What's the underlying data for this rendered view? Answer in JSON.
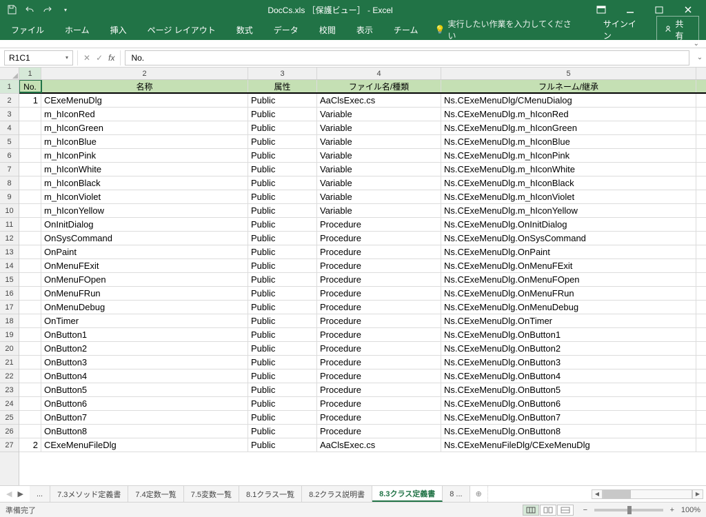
{
  "titlebar": {
    "title": "DocCs.xls ［保護ビュー］ - Excel"
  },
  "ribbon": {
    "tabs": [
      "ファイル",
      "ホーム",
      "挿入",
      "ページ レイアウト",
      "数式",
      "データ",
      "校閲",
      "表示",
      "チーム"
    ],
    "tellme": "実行したい作業を入力してください",
    "signin": "サインイン",
    "share": "共有"
  },
  "namebox": "R1C1",
  "formula": "No.",
  "columns": [
    "1",
    "2",
    "3",
    "4",
    "5"
  ],
  "headers": {
    "c1": "No.",
    "c2": "名称",
    "c3": "属性",
    "c4": "ファイル名/種類",
    "c5": "フルネーム/継承"
  },
  "rows": [
    {
      "no": "1",
      "name": "CExeMenuDlg",
      "attr": "Public",
      "file": "AaClsExec.cs",
      "full": "Ns.CExeMenuDlg/CMenuDialog"
    },
    {
      "no": "",
      "name": "m_hIconRed",
      "attr": "Public",
      "file": "Variable",
      "full": "Ns.CExeMenuDlg.m_hIconRed"
    },
    {
      "no": "",
      "name": "m_hIconGreen",
      "attr": "Public",
      "file": "Variable",
      "full": "Ns.CExeMenuDlg.m_hIconGreen"
    },
    {
      "no": "",
      "name": "m_hIconBlue",
      "attr": "Public",
      "file": "Variable",
      "full": "Ns.CExeMenuDlg.m_hIconBlue"
    },
    {
      "no": "",
      "name": "m_hIconPink",
      "attr": "Public",
      "file": "Variable",
      "full": "Ns.CExeMenuDlg.m_hIconPink"
    },
    {
      "no": "",
      "name": "m_hIconWhite",
      "attr": "Public",
      "file": "Variable",
      "full": "Ns.CExeMenuDlg.m_hIconWhite"
    },
    {
      "no": "",
      "name": "m_hIconBlack",
      "attr": "Public",
      "file": "Variable",
      "full": "Ns.CExeMenuDlg.m_hIconBlack"
    },
    {
      "no": "",
      "name": "m_hIconViolet",
      "attr": "Public",
      "file": "Variable",
      "full": "Ns.CExeMenuDlg.m_hIconViolet"
    },
    {
      "no": "",
      "name": "m_hIconYellow",
      "attr": "Public",
      "file": "Variable",
      "full": "Ns.CExeMenuDlg.m_hIconYellow"
    },
    {
      "no": "",
      "name": "OnInitDialog",
      "attr": "Public",
      "file": "Procedure",
      "full": "Ns.CExeMenuDlg.OnInitDialog"
    },
    {
      "no": "",
      "name": "OnSysCommand",
      "attr": "Public",
      "file": "Procedure",
      "full": "Ns.CExeMenuDlg.OnSysCommand"
    },
    {
      "no": "",
      "name": "OnPaint",
      "attr": "Public",
      "file": "Procedure",
      "full": "Ns.CExeMenuDlg.OnPaint"
    },
    {
      "no": "",
      "name": "OnMenuFExit",
      "attr": "Public",
      "file": "Procedure",
      "full": "Ns.CExeMenuDlg.OnMenuFExit"
    },
    {
      "no": "",
      "name": "OnMenuFOpen",
      "attr": "Public",
      "file": "Procedure",
      "full": "Ns.CExeMenuDlg.OnMenuFOpen"
    },
    {
      "no": "",
      "name": "OnMenuFRun",
      "attr": "Public",
      "file": "Procedure",
      "full": "Ns.CExeMenuDlg.OnMenuFRun"
    },
    {
      "no": "",
      "name": "OnMenuDebug",
      "attr": "Public",
      "file": "Procedure",
      "full": "Ns.CExeMenuDlg.OnMenuDebug"
    },
    {
      "no": "",
      "name": "OnTimer",
      "attr": "Public",
      "file": "Procedure",
      "full": "Ns.CExeMenuDlg.OnTimer"
    },
    {
      "no": "",
      "name": "OnButton1",
      "attr": "Public",
      "file": "Procedure",
      "full": "Ns.CExeMenuDlg.OnButton1"
    },
    {
      "no": "",
      "name": "OnButton2",
      "attr": "Public",
      "file": "Procedure",
      "full": "Ns.CExeMenuDlg.OnButton2"
    },
    {
      "no": "",
      "name": "OnButton3",
      "attr": "Public",
      "file": "Procedure",
      "full": "Ns.CExeMenuDlg.OnButton3"
    },
    {
      "no": "",
      "name": "OnButton4",
      "attr": "Public",
      "file": "Procedure",
      "full": "Ns.CExeMenuDlg.OnButton4"
    },
    {
      "no": "",
      "name": "OnButton5",
      "attr": "Public",
      "file": "Procedure",
      "full": "Ns.CExeMenuDlg.OnButton5"
    },
    {
      "no": "",
      "name": "OnButton6",
      "attr": "Public",
      "file": "Procedure",
      "full": "Ns.CExeMenuDlg.OnButton6"
    },
    {
      "no": "",
      "name": "OnButton7",
      "attr": "Public",
      "file": "Procedure",
      "full": "Ns.CExeMenuDlg.OnButton7"
    },
    {
      "no": "",
      "name": "OnButton8",
      "attr": "Public",
      "file": "Procedure",
      "full": "Ns.CExeMenuDlg.OnButton8"
    },
    {
      "no": "2",
      "name": "CExeMenuFileDlg",
      "attr": "Public",
      "file": "AaClsExec.cs",
      "full": "Ns.CExeMenuFileDlg/CExeMenuDlg"
    }
  ],
  "sheets": {
    "left_trunc": "...",
    "tabs": [
      "7.3メソッド定義書",
      "7.4定数一覧",
      "7.5変数一覧",
      "8.1クラス一覧",
      "8.2クラス説明書",
      "8.3クラス定義書"
    ],
    "right_trunc": "8 ...",
    "active_index": 5
  },
  "statusbar": {
    "status": "準備完了",
    "zoom": "100%"
  }
}
